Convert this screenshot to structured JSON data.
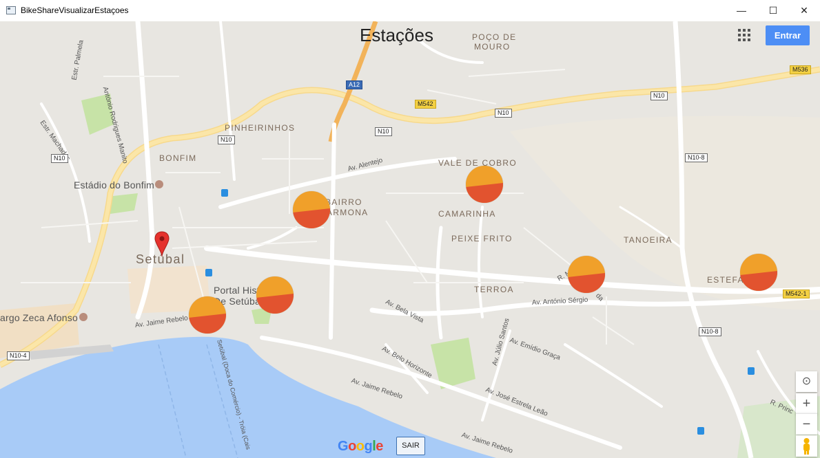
{
  "window": {
    "title": "BikeShareVisualizarEstaçoes",
    "minimize": "—",
    "maximize": "☐",
    "close": "✕"
  },
  "header": {
    "title": "Estações",
    "login_label": "Entrar"
  },
  "map_labels": {
    "areas": [
      "POÇO DE",
      "MOURO",
      "PINHEIRINHOS",
      "BONFIM",
      "VALE DE COBRO",
      "BAIRRO",
      "ARMONA",
      "CAMARINHA",
      "PEIXE FRITO",
      "TANOEIRA",
      "TERROA",
      "ESTEFA"
    ],
    "city": "Setúbal",
    "pois": [
      "Estádio do Bonfim",
      "Portal Histo",
      "De Setúbal",
      "argo Zeca Afonso"
    ],
    "streets": [
      "Estr. Palmela",
      "António Rodrigues Manito",
      "Estr. Machadas",
      "Av. Alentejo",
      "Av. Jaime Rebelo",
      "Av. Bela Vista",
      "Av. Belo Horizonte",
      "Av. Jaime Rebelo",
      "Av. José Estrela Leão",
      "Av. Jaime Rebelo",
      "Av. António Sérgio",
      "Av. Emídio Graça",
      "Av. Júlio Santos",
      "Setúbal (Doca do Comércio) - Tróia (Cais",
      "R. Princ",
      "R. M",
      "da"
    ],
    "roads": [
      "A12",
      "M542",
      "N10",
      "N10",
      "N10",
      "N10",
      "M536",
      "N10",
      "N10-8",
      "N10-8",
      "M542-1",
      "N10-4"
    ]
  },
  "stations": [
    {
      "name": "station-bairro-armona",
      "fill_fraction": 0.62
    },
    {
      "name": "station-vale-de-cobro",
      "fill_fraction": 0.55
    },
    {
      "name": "station-portal-historico",
      "fill_fraction": 0.6
    },
    {
      "name": "station-setubal-center",
      "fill_fraction": 0.58
    },
    {
      "name": "station-antonio-sergio",
      "fill_fraction": 0.57
    },
    {
      "name": "station-estefanilha",
      "fill_fraction": 0.6
    }
  ],
  "controls": {
    "locate": "⊙",
    "zoom_in": "+",
    "zoom_out": "−",
    "pegman": "pegman"
  },
  "footer": {
    "google_logo": "Google",
    "exit_label": "SAIR"
  },
  "colors": {
    "accent": "#4d8ef5",
    "station_orange": "#f0a02a",
    "station_red": "#e2532f",
    "water": "#a8cbf7",
    "park": "#c7e3a7"
  }
}
